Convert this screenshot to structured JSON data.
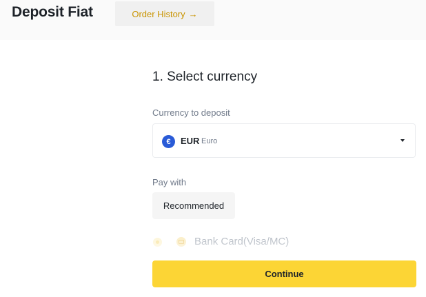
{
  "header": {
    "title": "Deposit Fiat",
    "order_history_label": "Order History",
    "order_history_arrow": "→"
  },
  "step": {
    "title": "1. Select currency"
  },
  "currency": {
    "label": "Currency to deposit",
    "selected_code": "EUR",
    "selected_name": "Euro",
    "icon_symbol": "€",
    "icon_color": "#2a5bd7"
  },
  "payment": {
    "label": "Pay with",
    "tab_label": "Recommended",
    "option_label": "Bank Card(Visa/MC)",
    "option_icon": "card-icon"
  },
  "actions": {
    "continue_label": "Continue",
    "accent_color": "#fcd535"
  }
}
